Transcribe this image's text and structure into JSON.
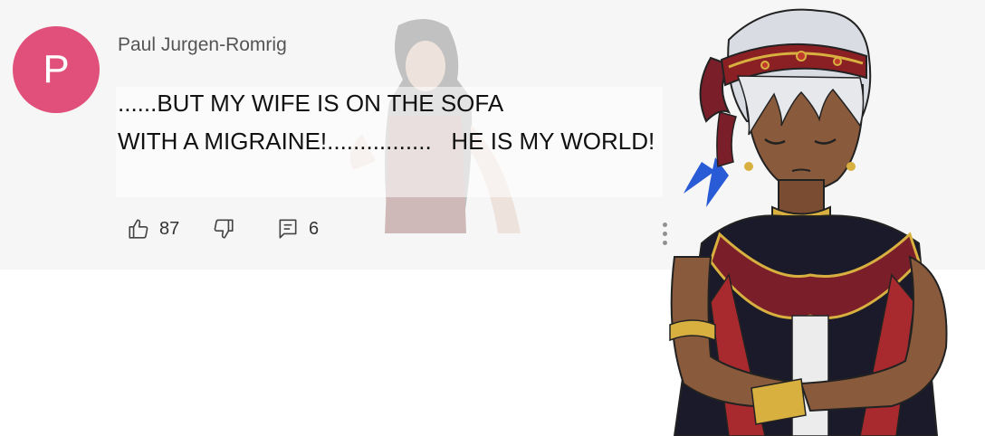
{
  "comment": {
    "avatar_letter": "P",
    "author": "Paul Jurgen-Romrig",
    "text_line_1": "......BUT MY WIFE IS ON THE SOFA",
    "text_line_2": "WITH A MIGRAINE!................   HE IS MY WORLD!",
    "likes": "87",
    "replies": "6"
  },
  "icons": {
    "like": "thumbs-up-icon",
    "dislike": "thumbs-down-icon",
    "reply": "comment-icon",
    "more": "more-vertical-icon"
  },
  "colors": {
    "avatar_bg": "#e0507a",
    "card_bg": "#f6f6f6"
  }
}
